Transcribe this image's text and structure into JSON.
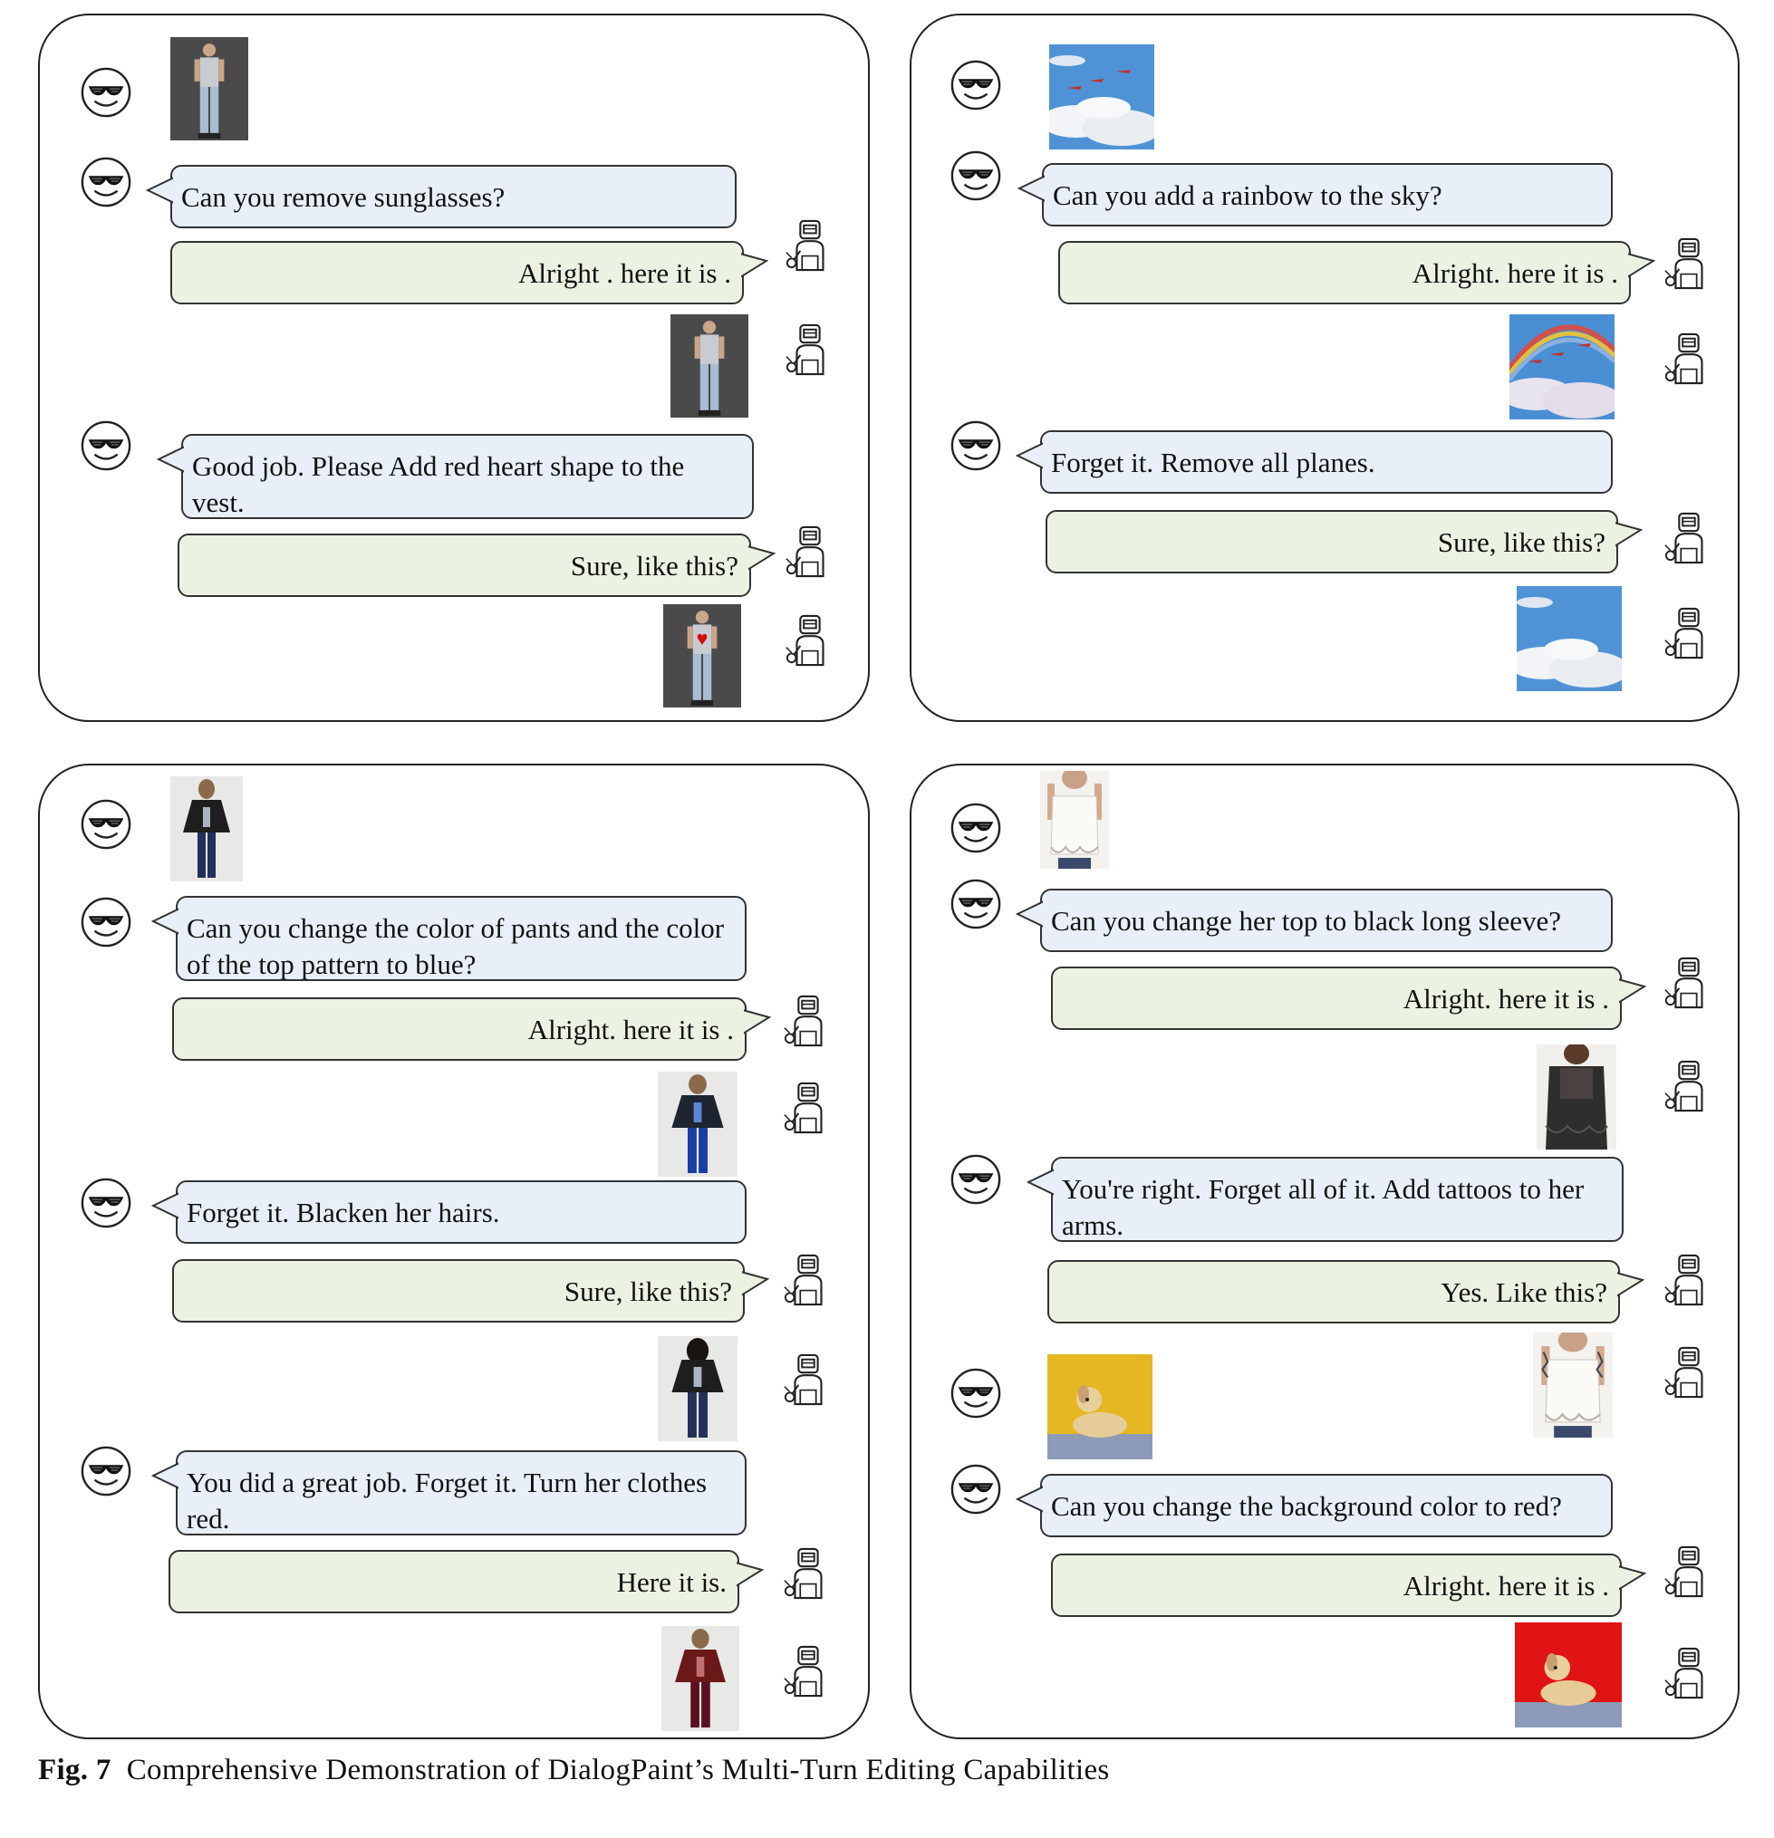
{
  "caption": {
    "label": "Fig. 7",
    "text": "Comprehensive Demonstration of DialogPaint’s Multi-Turn Editing Capabilities"
  },
  "colors": {
    "user_bubble": "#e8eff8",
    "bot_bubble": "#ebf2e2",
    "border": "#222222"
  },
  "icons": {
    "user": "sunglasses-smiley-icon",
    "assistant": "robot-welder-icon"
  },
  "panels": [
    {
      "id": "top-left",
      "turns": [
        {
          "text": "Can you remove sunglasses?"
        },
        {
          "text": "Alright . here it is ."
        },
        {
          "text": "Good job. Please Add red heart shape to the vest."
        },
        {
          "text": "Sure, like this?"
        }
      ]
    },
    {
      "id": "top-right",
      "turns": [
        {
          "text": "Can you add a rainbow to the sky?"
        },
        {
          "text": "Alright. here it is ."
        },
        {
          "text": "Forget it. Remove all planes."
        },
        {
          "text": "Sure, like this?"
        }
      ]
    },
    {
      "id": "bottom-left",
      "turns": [
        {
          "text": "Can you change the color of pants and the color of the top pattern to blue?"
        },
        {
          "text": "Alright. here it is ."
        },
        {
          "text": "Forget it. Blacken her hairs."
        },
        {
          "text": "Sure, like this?"
        },
        {
          "text": "You did a great job. Forget it. Turn her clothes red."
        },
        {
          "text": "Here it is."
        }
      ]
    },
    {
      "id": "bottom-right",
      "turns": [
        {
          "text": "Can you change her top to black long sleeve?"
        },
        {
          "text": "Alright. here it is ."
        },
        {
          "text": "You're right. Forget all of it. Add tattoos to her arms."
        },
        {
          "text": "Yes. Like this?"
        },
        {
          "text": "Can you change the background color to red?"
        },
        {
          "text": "Alright. here it is ."
        }
      ]
    }
  ]
}
